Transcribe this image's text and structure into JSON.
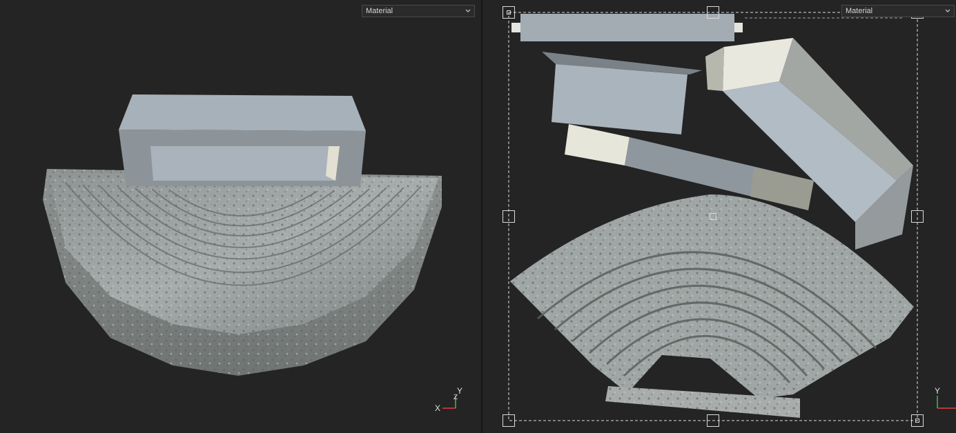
{
  "left_viewport": {
    "shading_dropdown": {
      "value": "Material",
      "icon": "chevron-down-icon"
    },
    "axis_gizmo": {
      "x_label": "X",
      "y_label": "Y",
      "z_label": "Z"
    }
  },
  "right_viewport": {
    "shading_dropdown": {
      "value": "Material",
      "icon": "chevron-down-icon"
    },
    "axis_gizmo": {
      "y_label": "Y"
    }
  },
  "colors": {
    "viewport_bg": "#242424",
    "axis_x": "#e04040",
    "axis_y": "#40c040",
    "selection": "#dcdcdc"
  }
}
